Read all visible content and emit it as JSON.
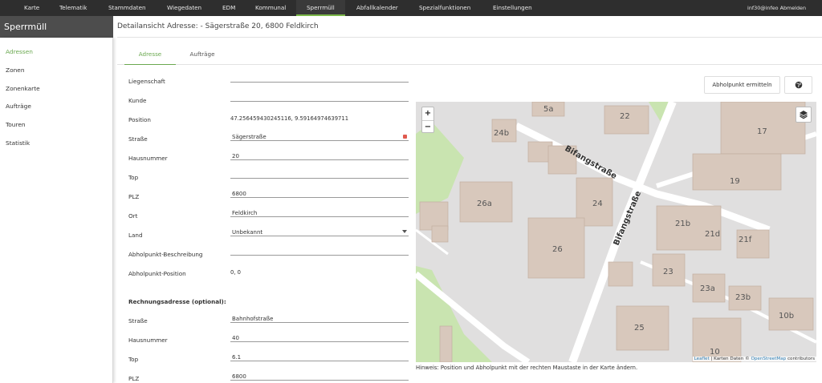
{
  "nav": {
    "items": [
      "Karte",
      "Telematik",
      "Stammdaten",
      "Wiegedaten",
      "EDM",
      "Kommunal",
      "Sperrmüll",
      "Abfallkalender",
      "Spezialfunktionen",
      "Einstellungen"
    ],
    "user": "inf30@infeo Abmelden"
  },
  "sidebar": {
    "brand": "Sperrmüll",
    "items": [
      "Adressen",
      "Zonen",
      "Zonenkarte",
      "Aufträge",
      "Touren",
      "Statistik"
    ]
  },
  "page": {
    "title": "Detailansicht Adresse: - Sägerstraße 20, 6800 Feldkirch"
  },
  "tabs": [
    "Adresse",
    "Aufträge"
  ],
  "form": {
    "labels": {
      "liegenschaft": "Liegenschaft",
      "kunde": "Kunde",
      "position": "Position",
      "strasse": "Straße",
      "hausnummer": "Hausnummer",
      "top": "Top",
      "plz": "PLZ",
      "ort": "Ort",
      "land": "Land",
      "beschreibung": "Abholpunkt-Beschreibung",
      "abholposition": "Abholpunkt-Position"
    },
    "values": {
      "liegenschaft": "",
      "kunde": "",
      "position": "47.256459430245116, 9.59164974639711",
      "strasse": "Sägerstraße",
      "hausnummer": "20",
      "top": "",
      "plz": "6800",
      "ort": "Feldkirch",
      "land": "Unbekannt",
      "beschreibung": "",
      "abholposition": "0, 0"
    },
    "billing_heading": "Rechnungsadresse (optional):",
    "billing_labels": {
      "strasse": "Straße",
      "hausnummer": "Hausnummer",
      "top": "Top",
      "plz": "PLZ"
    },
    "billing_values": {
      "strasse": "Bahnhofstraße",
      "hausnummer": "40",
      "top": "6.1",
      "plz": "6800"
    }
  },
  "buttons": {
    "abholpunkt": "Abholpunkt ermitteln",
    "globe_icon": "globe-icon"
  },
  "map": {
    "zoom_in": "+",
    "zoom_out": "−",
    "street_name": "Bifangstraße",
    "buildings": [
      "5a",
      "22",
      "24b",
      "17",
      "19",
      "26a",
      "24",
      "21b",
      "21d",
      "21f",
      "26",
      "23",
      "23a",
      "23b",
      "25",
      "10b",
      "10"
    ],
    "attribution": {
      "leaflet": "Leaflet",
      "sep": " | Karten Daten © ",
      "osm": "OpenStreetMap",
      "tail": " contributors"
    }
  },
  "hint": "Hinweis: Position und Abholpunkt mit der rechten Maustaste in der Karte ändern.",
  "colors": {
    "accent": "#6aa84f",
    "nav_bg": "#2e2e2e",
    "sidebar_header": "#4d4d4d"
  }
}
